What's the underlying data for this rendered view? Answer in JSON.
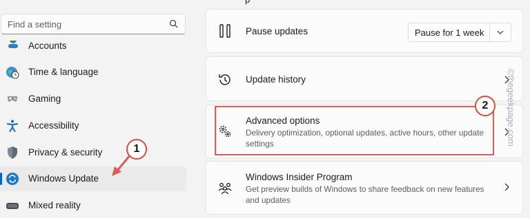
{
  "search": {
    "placeholder": "Find a setting",
    "icon": "search-icon"
  },
  "sidebar": {
    "items": [
      {
        "label": "Accounts",
        "icon": "accounts-icon"
      },
      {
        "label": "Time & language",
        "icon": "globe-clock-icon"
      },
      {
        "label": "Gaming",
        "icon": "gamepad-icon"
      },
      {
        "label": "Accessibility",
        "icon": "accessibility-icon"
      },
      {
        "label": "Privacy & security",
        "icon": "shield-icon"
      },
      {
        "label": "Windows Update",
        "icon": "windows-update-icon",
        "active": true
      },
      {
        "label": "Mixed reality",
        "icon": "vr-headset-icon"
      }
    ]
  },
  "main": {
    "pause": {
      "title": "Pause updates",
      "button": "Pause for 1 week",
      "icon": "pause-icon"
    },
    "history": {
      "title": "Update history",
      "icon": "history-icon"
    },
    "advanced": {
      "title": "Advanced options",
      "subtitle": "Delivery optimization, optional updates, active hours, other update settings",
      "icon": "gears-icon"
    },
    "insider": {
      "title": "Windows Insider Program",
      "subtitle": "Get preview builds of Windows to share feedback on new features and updates",
      "icon": "insider-icon"
    }
  },
  "annotations": {
    "callout_1": "1",
    "callout_2": "2",
    "color": "#d94c3c"
  },
  "watermark": "©thegeekpage.com",
  "colors": {
    "accent": "#0067c0",
    "highlight": "#e05a5a"
  }
}
